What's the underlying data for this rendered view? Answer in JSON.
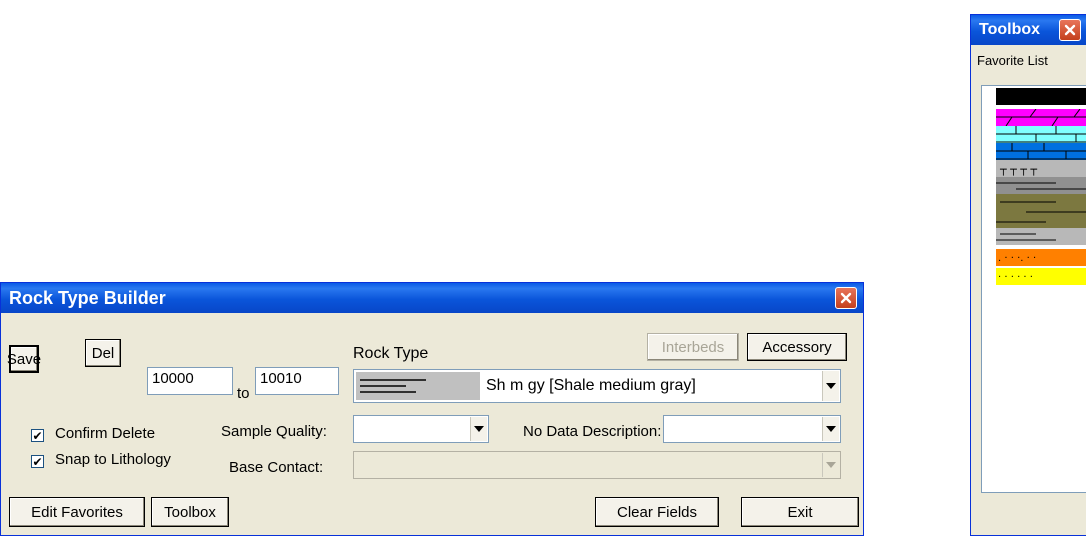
{
  "rock_type_builder": {
    "title": "Rock Type Builder",
    "save_label": "Save",
    "del_label": "Del",
    "from_value": "10000",
    "to_label": "to",
    "to_value": "10010",
    "rock_type_label": "Rock Type",
    "rock_type_value": "Sh m gy [Shale medium gray]",
    "interbeds_label": "Interbeds",
    "accessory_label": "Accessory",
    "confirm_delete_label": "Confirm Delete",
    "confirm_delete_checked": true,
    "snap_label": "Snap to Lithology",
    "snap_checked": true,
    "sample_quality_label": "Sample Quality:",
    "sample_quality_value": "",
    "no_data_label": "No Data Description:",
    "no_data_value": "",
    "base_contact_label": "Base Contact:",
    "base_contact_value": "",
    "edit_favorites_label": "Edit Favorites",
    "toolbox_label": "Toolbox",
    "clear_fields_label": "Clear Fields",
    "exit_label": "Exit"
  },
  "toolbox": {
    "title": "Toolbox",
    "favorite_list_label": "Favorite List",
    "swatch_colors": [
      "#000000",
      "#ff00ff",
      "#80ffff",
      "#0070e0",
      "#b8b8b8",
      "#909090",
      "#7c7840",
      "#b8b8b8",
      "#ff8000",
      "#ffff00"
    ]
  },
  "colors": {
    "titlebar_blue": "#0a5ae6",
    "window_face": "#ece9d8",
    "close_red": "#d9532c"
  }
}
